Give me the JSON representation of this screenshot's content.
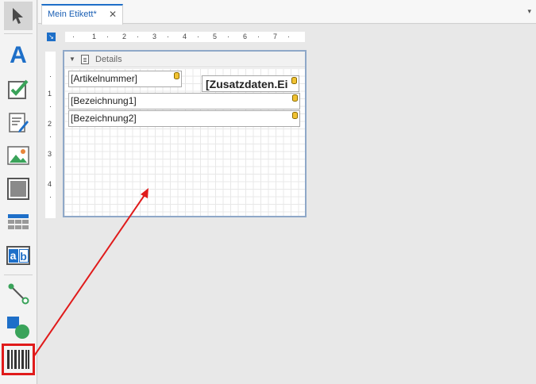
{
  "tabs": [
    {
      "label": "Mein Etikett*",
      "close_glyph": "✕"
    }
  ],
  "overflow_glyph": "▾",
  "toolbox": [
    {
      "name": "pointer-tool",
      "icon": "arrow-pointer-icon"
    },
    {
      "name": "text-tool",
      "icon": "letter-a-icon",
      "glyph": "A"
    },
    {
      "name": "checkbox-tool",
      "icon": "checkbox-icon"
    },
    {
      "name": "richtext-tool",
      "icon": "edit-document-icon"
    },
    {
      "name": "picture-tool",
      "icon": "picture-icon"
    },
    {
      "name": "panel-tool",
      "icon": "panel-icon"
    },
    {
      "name": "table-tool",
      "icon": "table-icon"
    },
    {
      "name": "character-comb-tool",
      "icon": "ab-comb-icon",
      "glyph_a": "a",
      "glyph_b": "b"
    },
    {
      "name": "line-tool",
      "icon": "line-icon"
    },
    {
      "name": "shape-tool",
      "icon": "shape-icon"
    },
    {
      "name": "barcode-tool",
      "icon": "barcode-icon"
    }
  ],
  "rulers": {
    "horizontal": [
      "1",
      "2",
      "3",
      "4",
      "5",
      "6",
      "7"
    ],
    "vertical": [
      "1",
      "2",
      "3",
      "4"
    ]
  },
  "band": {
    "title": "Details"
  },
  "fields": {
    "artikelnummer": "[Artikelnummer]",
    "zusatzdaten": "[Zusatzdaten.Ei",
    "bezeichnung1": "[Bezeichnung1]",
    "bezeichnung2": "[Bezeichnung2]"
  },
  "colors": {
    "accent": "#1e6fc8",
    "annotation": "#e01b1b",
    "check_green": "#3aa35a"
  }
}
